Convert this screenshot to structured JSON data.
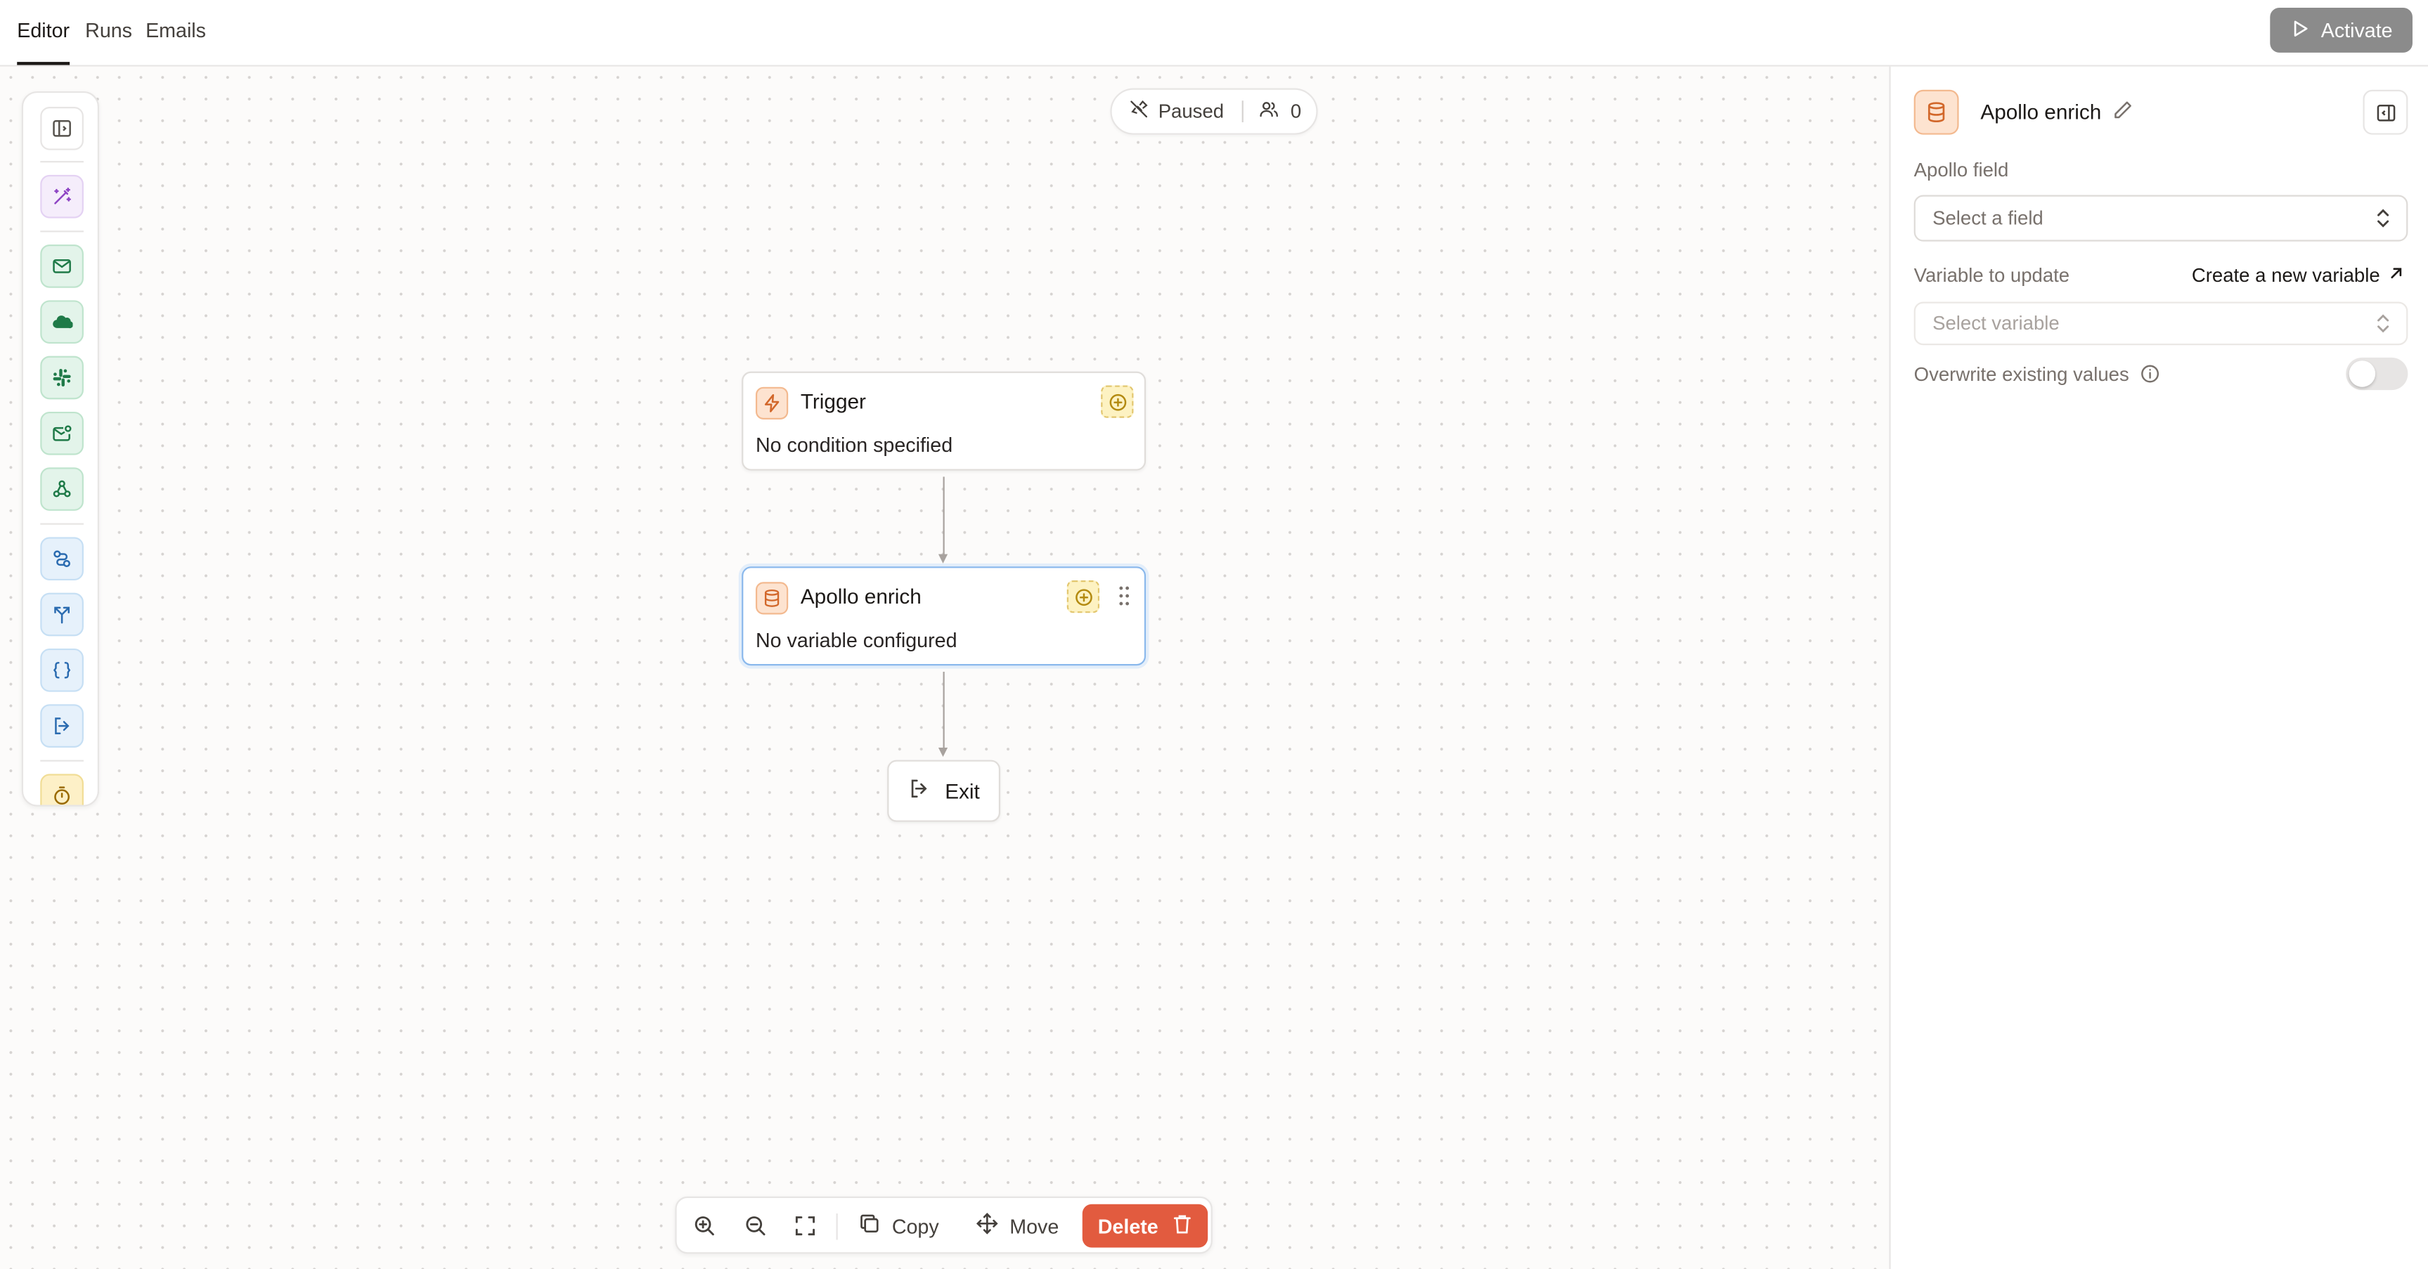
{
  "tabs": [
    {
      "label": "Editor",
      "active": true
    },
    {
      "label": "Runs",
      "active": false
    },
    {
      "label": "Emails",
      "active": false
    }
  ],
  "header": {
    "activate_label": "Activate"
  },
  "status": {
    "state": "Paused",
    "count": "0"
  },
  "toolbar": {
    "tools": [
      "sidebar-toggle",
      "magic-wand",
      "email",
      "salesforce",
      "slack",
      "email-notify",
      "webhook",
      "branch-route",
      "split",
      "code",
      "exit",
      "delay"
    ]
  },
  "nodes": {
    "trigger": {
      "title": "Trigger",
      "subtitle": "No condition specified",
      "icon": "lightning-icon"
    },
    "apollo": {
      "title": "Apollo enrich",
      "subtitle": "No variable configured",
      "icon": "database-icon"
    },
    "exit": {
      "title": "Exit",
      "icon": "exit-icon"
    }
  },
  "bottombar": {
    "copy_label": "Copy",
    "move_label": "Move",
    "delete_label": "Delete"
  },
  "panel": {
    "title": "Apollo enrich",
    "apollo_field_label": "Apollo field",
    "apollo_field_placeholder": "Select a field",
    "variable_label": "Variable to update",
    "create_variable_label": "Create a new variable",
    "variable_placeholder": "Select variable",
    "overwrite_label": "Overwrite existing values",
    "overwrite_enabled": false
  },
  "colors": {
    "accent_orange": "#e25b3f",
    "node_orange": "#d2672a",
    "selected_border": "#8ab8ec"
  }
}
